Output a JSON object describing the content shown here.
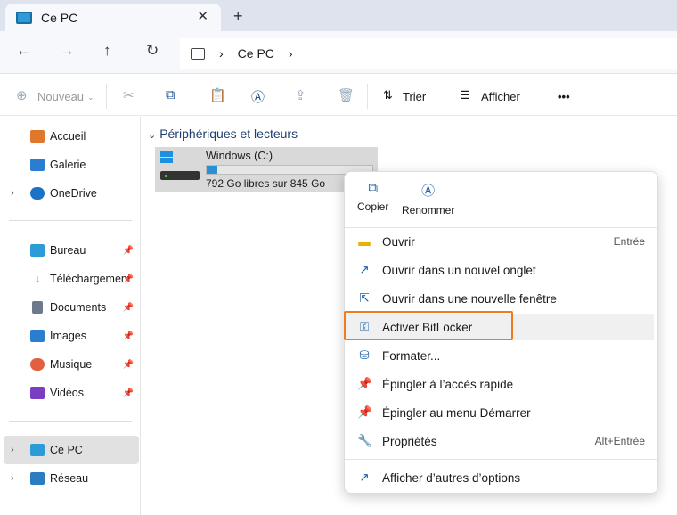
{
  "tab": {
    "title": "Ce PC",
    "close": "✕",
    "new": "+"
  },
  "nav": {
    "back": "←",
    "forward": "→",
    "up": "↑",
    "refresh": "↻",
    "breadcrumb": [
      "Ce PC"
    ]
  },
  "toolbar": {
    "new": "Nouveau",
    "sort": "Trier",
    "view": "Afficher",
    "more": "•••"
  },
  "sidebar": {
    "quick": [
      {
        "label": "Accueil",
        "color": "#e0782b"
      },
      {
        "label": "Galerie",
        "color": "#2a7dd1"
      },
      {
        "label": "OneDrive",
        "color": "#1a73c9"
      }
    ],
    "pinned": [
      {
        "label": "Bureau",
        "color": "#2b9cd8"
      },
      {
        "label": "Téléchargements",
        "color": "#2a9a5a"
      },
      {
        "label": "Documents",
        "color": "#6c7a8c"
      },
      {
        "label": "Images",
        "color": "#2a7dd1"
      },
      {
        "label": "Musique",
        "color": "#e06040"
      },
      {
        "label": "Vidéos",
        "color": "#7a3fc0"
      }
    ],
    "bottom": [
      {
        "label": "Ce PC",
        "color": "#2b9cd8"
      },
      {
        "label": "Réseau",
        "color": "#2b7cc0"
      }
    ]
  },
  "main": {
    "section": "Périphériques et lecteurs",
    "drive": {
      "name": "Windows (C:)",
      "free": "792 Go libres sur 845 Go",
      "used_percent": 6.3
    }
  },
  "menu": {
    "quick": [
      {
        "label": "Copier",
        "icon": "⧉"
      },
      {
        "label": "Renommer",
        "icon": "Ⓐ"
      }
    ],
    "items": [
      {
        "label": "Ouvrir",
        "shortcut": "Entrée",
        "icon": "▬"
      },
      {
        "label": "Ouvrir dans un nouvel onglet",
        "icon": "↗"
      },
      {
        "label": "Ouvrir dans une nouvelle fenêtre",
        "icon": "⇱"
      },
      {
        "label": "Activer BitLocker",
        "icon": "⚿"
      },
      {
        "label": "Formater...",
        "icon": "⛁"
      },
      {
        "label": "Épingler à l’accès rapide",
        "icon": "📌"
      },
      {
        "label": "Épingler au menu Démarrer",
        "icon": "📌"
      },
      {
        "label": "Propriétés",
        "shortcut": "Alt+Entrée",
        "icon": "🔧"
      }
    ],
    "more": {
      "label": "Afficher d’autres d’options",
      "icon": "↗"
    }
  },
  "colors": {
    "accent": "#2b8fd6",
    "highlight": "#f07a1e"
  }
}
